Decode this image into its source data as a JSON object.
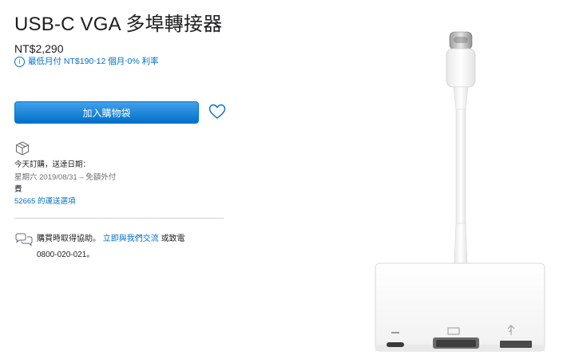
{
  "product": {
    "title": "USB-C VGA 多埠轉接器",
    "price": "NT$2,290",
    "installment_icon": "info-icon",
    "installment_text": "最低月付 NT$190‧12 個月‧0% 利率"
  },
  "actions": {
    "add_to_bag_label": "加入購物袋",
    "favorite_icon": "heart-icon"
  },
  "shipping": {
    "icon": "box-icon",
    "title": "今天訂購，送達日期：",
    "date_line": "星期六 2019/08/31 – 免額外付",
    "date_cont": "費",
    "zip_link": "52665 的運送選項"
  },
  "help": {
    "icon": "chat-bubbles-icon",
    "prefix": "購買時取得協助。",
    "link": "立即與我們交流",
    "suffix": " 或致電",
    "phone": "0800-020-021。"
  },
  "image": {
    "alt": "USB-C VGA 多埠轉接器"
  },
  "colors": {
    "accent": "#0070c9",
    "button_top": "#42a1ec",
    "text": "#1d1d1f",
    "secondary": "#6e6e73"
  }
}
